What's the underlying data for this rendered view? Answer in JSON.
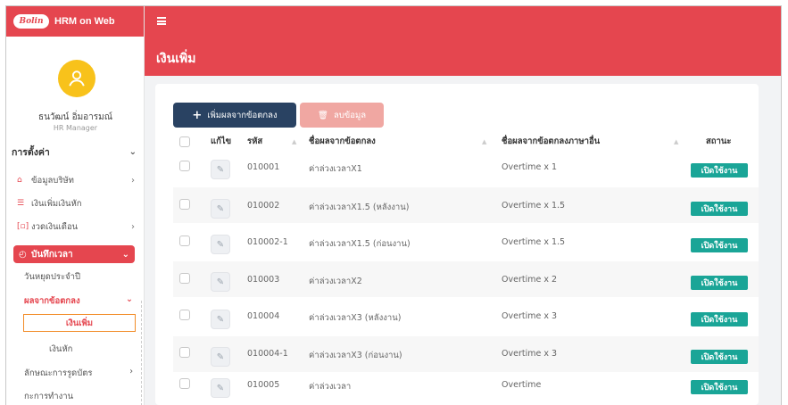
{
  "brand": {
    "logo_text": "Bolin",
    "app_name": "HRM on Web"
  },
  "user": {
    "name": "ธนวัฒน์ อิ่มอารมณ์",
    "role": "HR Manager"
  },
  "menu": {
    "title": "การตั้งค่า",
    "items": [
      {
        "label": "ข้อมูลบริษัท",
        "icon": "home-icon"
      },
      {
        "label": "เงินเพิ่มเงินหัก",
        "icon": "list-icon"
      },
      {
        "label": "งวดเงินเดือน",
        "icon": "calendar-icon"
      }
    ],
    "active": "บันทึกเวลา",
    "sub": {
      "holiday": "วันหยุดประจำปี",
      "ot_result": "ผลจากข้อตกลง",
      "selected": "เงินเพิ่ม",
      "deduct": "เงินหัก",
      "card_type": "ลักษณะการรูดบัตร",
      "process": "กะการทำงาน"
    }
  },
  "page": {
    "title": "เงินเพิ่ม"
  },
  "toolbar": {
    "add_label": "เพิ่มผลจากข้อตกลง",
    "delete_label": "ลบข้อมูล"
  },
  "table": {
    "headers": {
      "edit": "แก้ไข",
      "code": "รหัส",
      "name": "ชื่อผลจากข้อตกลง",
      "name_alt": "ชื่อผลจากข้อตกลงภาษาอื่น",
      "status": "สถานะ"
    },
    "rows": [
      {
        "code": "010001",
        "name": "ค่าล่วงเวลาX1",
        "name_alt": "Overtime x 1",
        "status": "เปิดใช้งาน"
      },
      {
        "code": "010002",
        "name": "ค่าล่วงเวลาX1.5 (หลังงาน)",
        "name_alt": "Overtime x 1.5",
        "status": "เปิดใช้งาน"
      },
      {
        "code": "010002-1",
        "name": "ค่าล่วงเวลาX1.5 (ก่อนงาน)",
        "name_alt": "Overtime x 1.5",
        "status": "เปิดใช้งาน"
      },
      {
        "code": "010003",
        "name": "ค่าล่วงเวลาX2",
        "name_alt": "Overtime x 2",
        "status": "เปิดใช้งาน"
      },
      {
        "code": "010004",
        "name": "ค่าล่วงเวลาX3 (หลังงาน)",
        "name_alt": "Overtime x 3",
        "status": "เปิดใช้งาน"
      },
      {
        "code": "010004-1",
        "name": "ค่าล่วงเวลาX3 (ก่อนงาน)",
        "name_alt": "Overtime x 3",
        "status": "เปิดใช้งาน"
      },
      {
        "code": "010005",
        "name": "ค่าล่วงเวลา",
        "name_alt": "Overtime",
        "status": "เปิดใช้งาน"
      }
    ]
  },
  "colors": {
    "primary": "#e5464f",
    "navy": "#294262",
    "active_badge": "#1aa597"
  }
}
